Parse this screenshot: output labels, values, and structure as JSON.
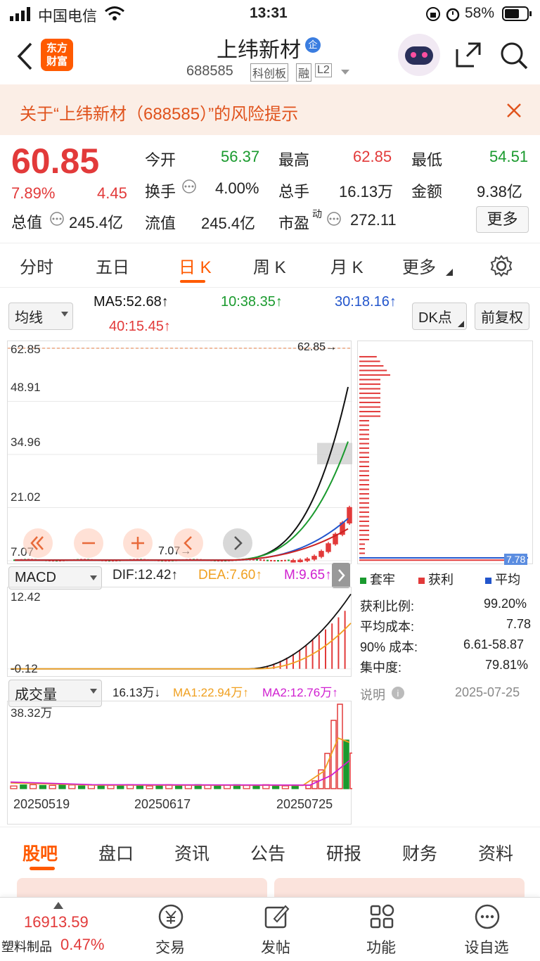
{
  "status_bar": {
    "carrier": "中国电信",
    "time": "13:31",
    "battery": "58%"
  },
  "header": {
    "logo_text_1": "东方",
    "logo_text_2": "财富",
    "stock_name": "上纬新材",
    "badge": "企",
    "code": "688585",
    "tags": [
      "科创板",
      "融",
      "L2"
    ]
  },
  "banner": {
    "text": "关于“上纬新材（688585）”的风险提示"
  },
  "quote": {
    "price": "60.85",
    "pct": "7.89%",
    "change": "4.45",
    "market_cap_label": "总值",
    "market_cap": "245.4亿",
    "fields": {
      "open_label": "今开",
      "open": "56.37",
      "high_label": "最高",
      "high": "62.85",
      "low_label": "最低",
      "low": "54.51",
      "turnover_label": "换手",
      "turnover": "4.00%",
      "volume_label": "总手",
      "volume": "16.13万",
      "amount_label": "金额",
      "amount": "9.38亿",
      "float_label": "流值",
      "float": "245.4亿",
      "pe_label": "市盈",
      "pe_sup": "动",
      "pe": "272.11"
    },
    "more_button": "更多"
  },
  "tabs": [
    "分时",
    "五日",
    "日 K",
    "周 K",
    "月 K",
    "更多"
  ],
  "ma": {
    "selector": "均线",
    "ma5": "MA5:52.68↑",
    "ma10": "10:38.35↑",
    "ma30": "30:18.16↑",
    "ma40": "40:15.45↑",
    "dk_button": "DK点",
    "fq_button": "前复权"
  },
  "kline": {
    "y_ticks": [
      "62.85",
      "48.91",
      "34.96",
      "21.02",
      "7.07"
    ],
    "high_label": "62.85→",
    "low_label": "7.07→",
    "cost_label": "7.78"
  },
  "macd": {
    "selector": "MACD",
    "dif": "DIF:12.42↑",
    "dea": "DEA:7.60↑",
    "m": "M:9.65↑",
    "y_ticks": [
      "12.42",
      "-0.12"
    ]
  },
  "volume": {
    "selector": "成交量",
    "vol": "16.13万↓",
    "ma1": "MA1:22.94万↑",
    "ma2": "MA2:12.76万↑",
    "y_tick": "38.32万",
    "dates": [
      "20250519",
      "20250617",
      "20250725"
    ]
  },
  "chips": {
    "legend": [
      "套牢",
      "获利",
      "平均"
    ],
    "rows": [
      {
        "label": "获利比例:",
        "value": "99.20%"
      },
      {
        "label": "平均成本:",
        "value": "7.78"
      },
      {
        "label": "90% 成本:",
        "value": "6.61-58.87"
      },
      {
        "label": "集中度:",
        "value": "79.81%"
      }
    ],
    "note_label": "说明",
    "date": "2025-07-25"
  },
  "bottom_tabs": [
    "股吧",
    "盘口",
    "资讯",
    "公告",
    "研报",
    "财务",
    "资料"
  ],
  "ticker": {
    "value": "16913.59",
    "name": "塑料制品",
    "pct": "0.47%"
  },
  "toolbar": [
    "交易",
    "发帖",
    "功能",
    "设自选"
  ],
  "colors": {
    "up": "#e23a3a",
    "down": "#1a9a2e",
    "accent": "#ff5a00",
    "ma5": "#111111",
    "ma10": "#1a9a2e",
    "ma30": "#2255cc",
    "ma40": "#cc2222"
  },
  "chart_data": {
    "type": "candlestick",
    "title": "",
    "y_ticks": [
      62.85,
      48.91,
      34.96,
      21.02,
      7.07
    ],
    "ylim": [
      7.07,
      62.85
    ],
    "x_ticks": [
      "20250519",
      "20250617",
      "20250725"
    ],
    "recent_closes": [
      7.1,
      7.2,
      7.5,
      8.2,
      9.5,
      11.5,
      14.0,
      17.0,
      21.0,
      26.0,
      32.0,
      38.0,
      45.0,
      52.0,
      56.4,
      60.85
    ],
    "series": [
      {
        "name": "MA5",
        "last": 52.68
      },
      {
        "name": "10",
        "last": 38.35
      },
      {
        "name": "30",
        "last": 18.16
      },
      {
        "name": "40",
        "last": 15.45
      }
    ]
  }
}
